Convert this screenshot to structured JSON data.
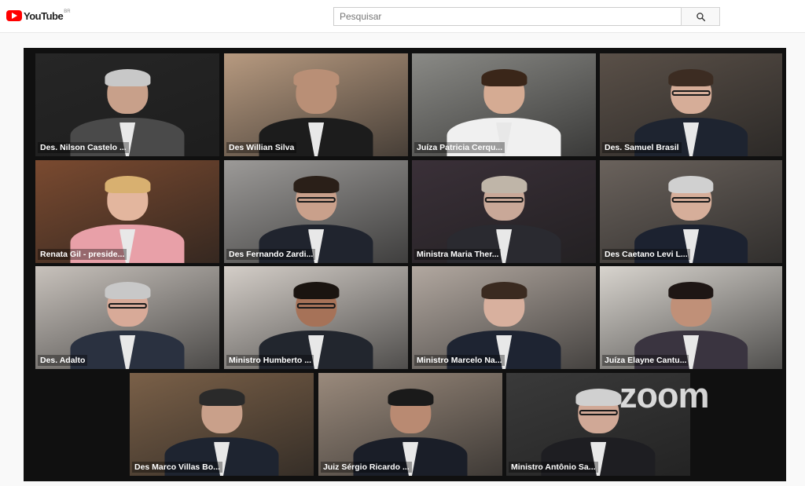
{
  "header": {
    "logo_text": "YouTube",
    "region": "BR",
    "search_placeholder": "Pesquisar"
  },
  "meeting": {
    "watermark": "zoom",
    "active_speaker_color": "#7bd94a",
    "participants": [
      {
        "name": "Des. Nilson Castelo ...",
        "bg": "#262626",
        "skin": "#c8a08a",
        "suit": "#4a4a4a",
        "hair": "#c8c8c8",
        "glasses": false
      },
      {
        "name": "Des Willian Silva",
        "bg": "#b79a80",
        "skin": "#b98f76",
        "suit": "#1c1c1c",
        "hair": "#b98f76",
        "glasses": false
      },
      {
        "name": "Juíza Patricia Cerqu...",
        "bg": "#8a8a86",
        "skin": "#d5ab93",
        "suit": "#f0f0f0",
        "hair": "#3a2619",
        "glasses": false
      },
      {
        "name": "Des. Samuel Brasil",
        "bg": "#5a5048",
        "skin": "#d6ad98",
        "suit": "#1e2430",
        "hair": "#3c2c22",
        "glasses": true
      },
      {
        "name": "Renata Gil - preside...",
        "bg": "#7a4a30",
        "skin": "#e3b69e",
        "suit": "#e8a0a8",
        "hair": "#d8b070",
        "glasses": false
      },
      {
        "name": "Des Fernando Zardi...",
        "bg": "#9c9a98",
        "skin": "#c9a08b",
        "suit": "#20242e",
        "hair": "#2a1f18",
        "glasses": true
      },
      {
        "name": "Ministra Maria Ther...",
        "bg": "#3a3038",
        "skin": "#c9a898",
        "suit": "#2a2a30",
        "hair": "#bfb5a8",
        "glasses": true
      },
      {
        "name": "Des Caetano Levi L...",
        "bg": "#6a625c",
        "skin": "#d6ae9a",
        "suit": "#1c2230",
        "hair": "#d0d0d0",
        "glasses": true
      },
      {
        "name": "Des. Adalto",
        "bg": "#c8c2bc",
        "skin": "#d8aa98",
        "suit": "#2a3140",
        "hair": "#c8c8c8",
        "glasses": true
      },
      {
        "name": "Ministro Humberto ...",
        "bg": "#d4cec8",
        "skin": "#a67258",
        "suit": "#22262e",
        "hair": "#1a1410",
        "glasses": true
      },
      {
        "name": "Ministro Marcelo Na...",
        "bg": "#b2a8a0",
        "skin": "#d8b09e",
        "suit": "#1e2432",
        "hair": "#3a2a20",
        "glasses": false
      },
      {
        "name": "Juíza Elayne Cantu...",
        "bg": "#d8d4ce",
        "skin": "#c09078",
        "suit": "#3a3440",
        "hair": "#1e1614",
        "glasses": false
      },
      {
        "name": "Des Marco Villas Bo...",
        "bg": "#7a6048",
        "skin": "#c9a08a",
        "suit": "#1e2430",
        "hair": "#2a2a2a",
        "glasses": false
      },
      {
        "name": "Juiz Sérgio Ricardo ...",
        "bg": "#9a8a7c",
        "skin": "#b98a72",
        "suit": "#1a1e28",
        "hair": "#1a1a1a",
        "glasses": false
      },
      {
        "name": "Ministro Antônio Sa...",
        "bg": "#3a3a3a",
        "skin": "#d0a896",
        "suit": "#1e1e22",
        "hair": "#d0d0d0",
        "glasses": true
      }
    ]
  }
}
